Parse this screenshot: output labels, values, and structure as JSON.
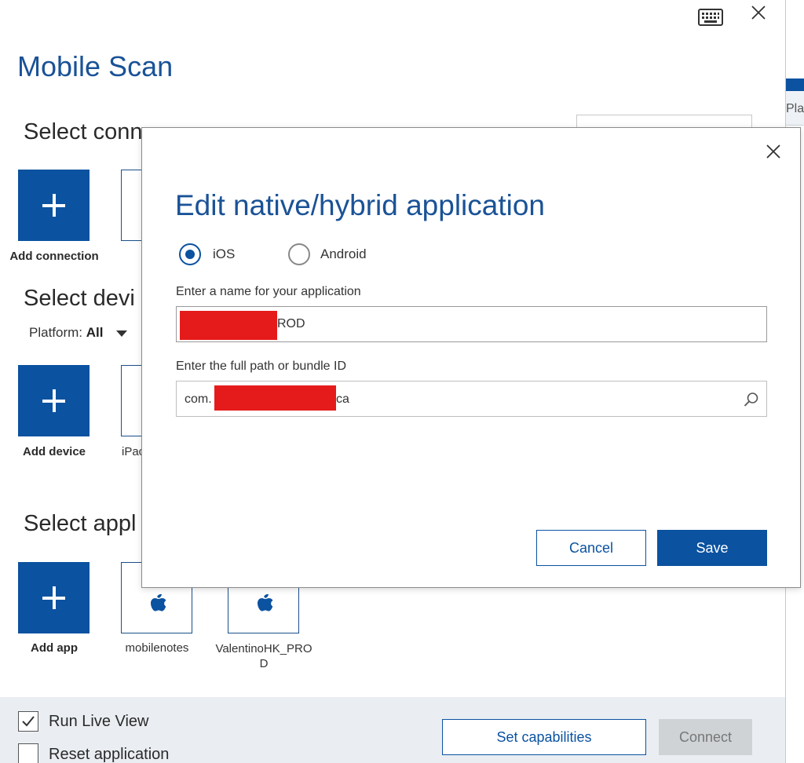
{
  "app": {
    "title": "Mobile Scan"
  },
  "sections": {
    "connection": "Select conn",
    "device": "Select devi",
    "app": "Select appl"
  },
  "connection": {
    "add_label": "Add connection"
  },
  "device": {
    "platform_label": "Platform:",
    "platform_value": "All",
    "add_label": "Add device",
    "tiles": [
      {
        "label": "iPac"
      }
    ]
  },
  "apps": {
    "add_label": "Add app",
    "tiles": [
      {
        "label": "mobilenotes",
        "icon": "apple-icon"
      },
      {
        "label": "ValentinoHK_PROD",
        "icon": "apple-icon"
      }
    ]
  },
  "right_panel": {
    "stub_label": "Pla"
  },
  "footer": {
    "run_live_view": "Run Live View",
    "run_live_view_checked": true,
    "reset_application": "Reset application",
    "reset_application_checked": false,
    "set_capabilities": "Set capabilities",
    "connect": "Connect"
  },
  "dialog": {
    "title": "Edit native/hybrid application",
    "platforms": [
      {
        "label": "iOS",
        "selected": true
      },
      {
        "label": "Android",
        "selected": false
      }
    ],
    "name_label": "Enter a name for your application",
    "name_value_visible": "ROD",
    "path_label": "Enter the full path or bundle ID",
    "path_prefix": "com.",
    "path_suffix": "ca",
    "cancel": "Cancel",
    "save": "Save"
  },
  "colors": {
    "accent": "#0b52a0",
    "title": "#1a5296",
    "redaction": "#e51b1b",
    "footer_bg": "#eaeef2",
    "disabled_button": "#cfd3d6"
  }
}
